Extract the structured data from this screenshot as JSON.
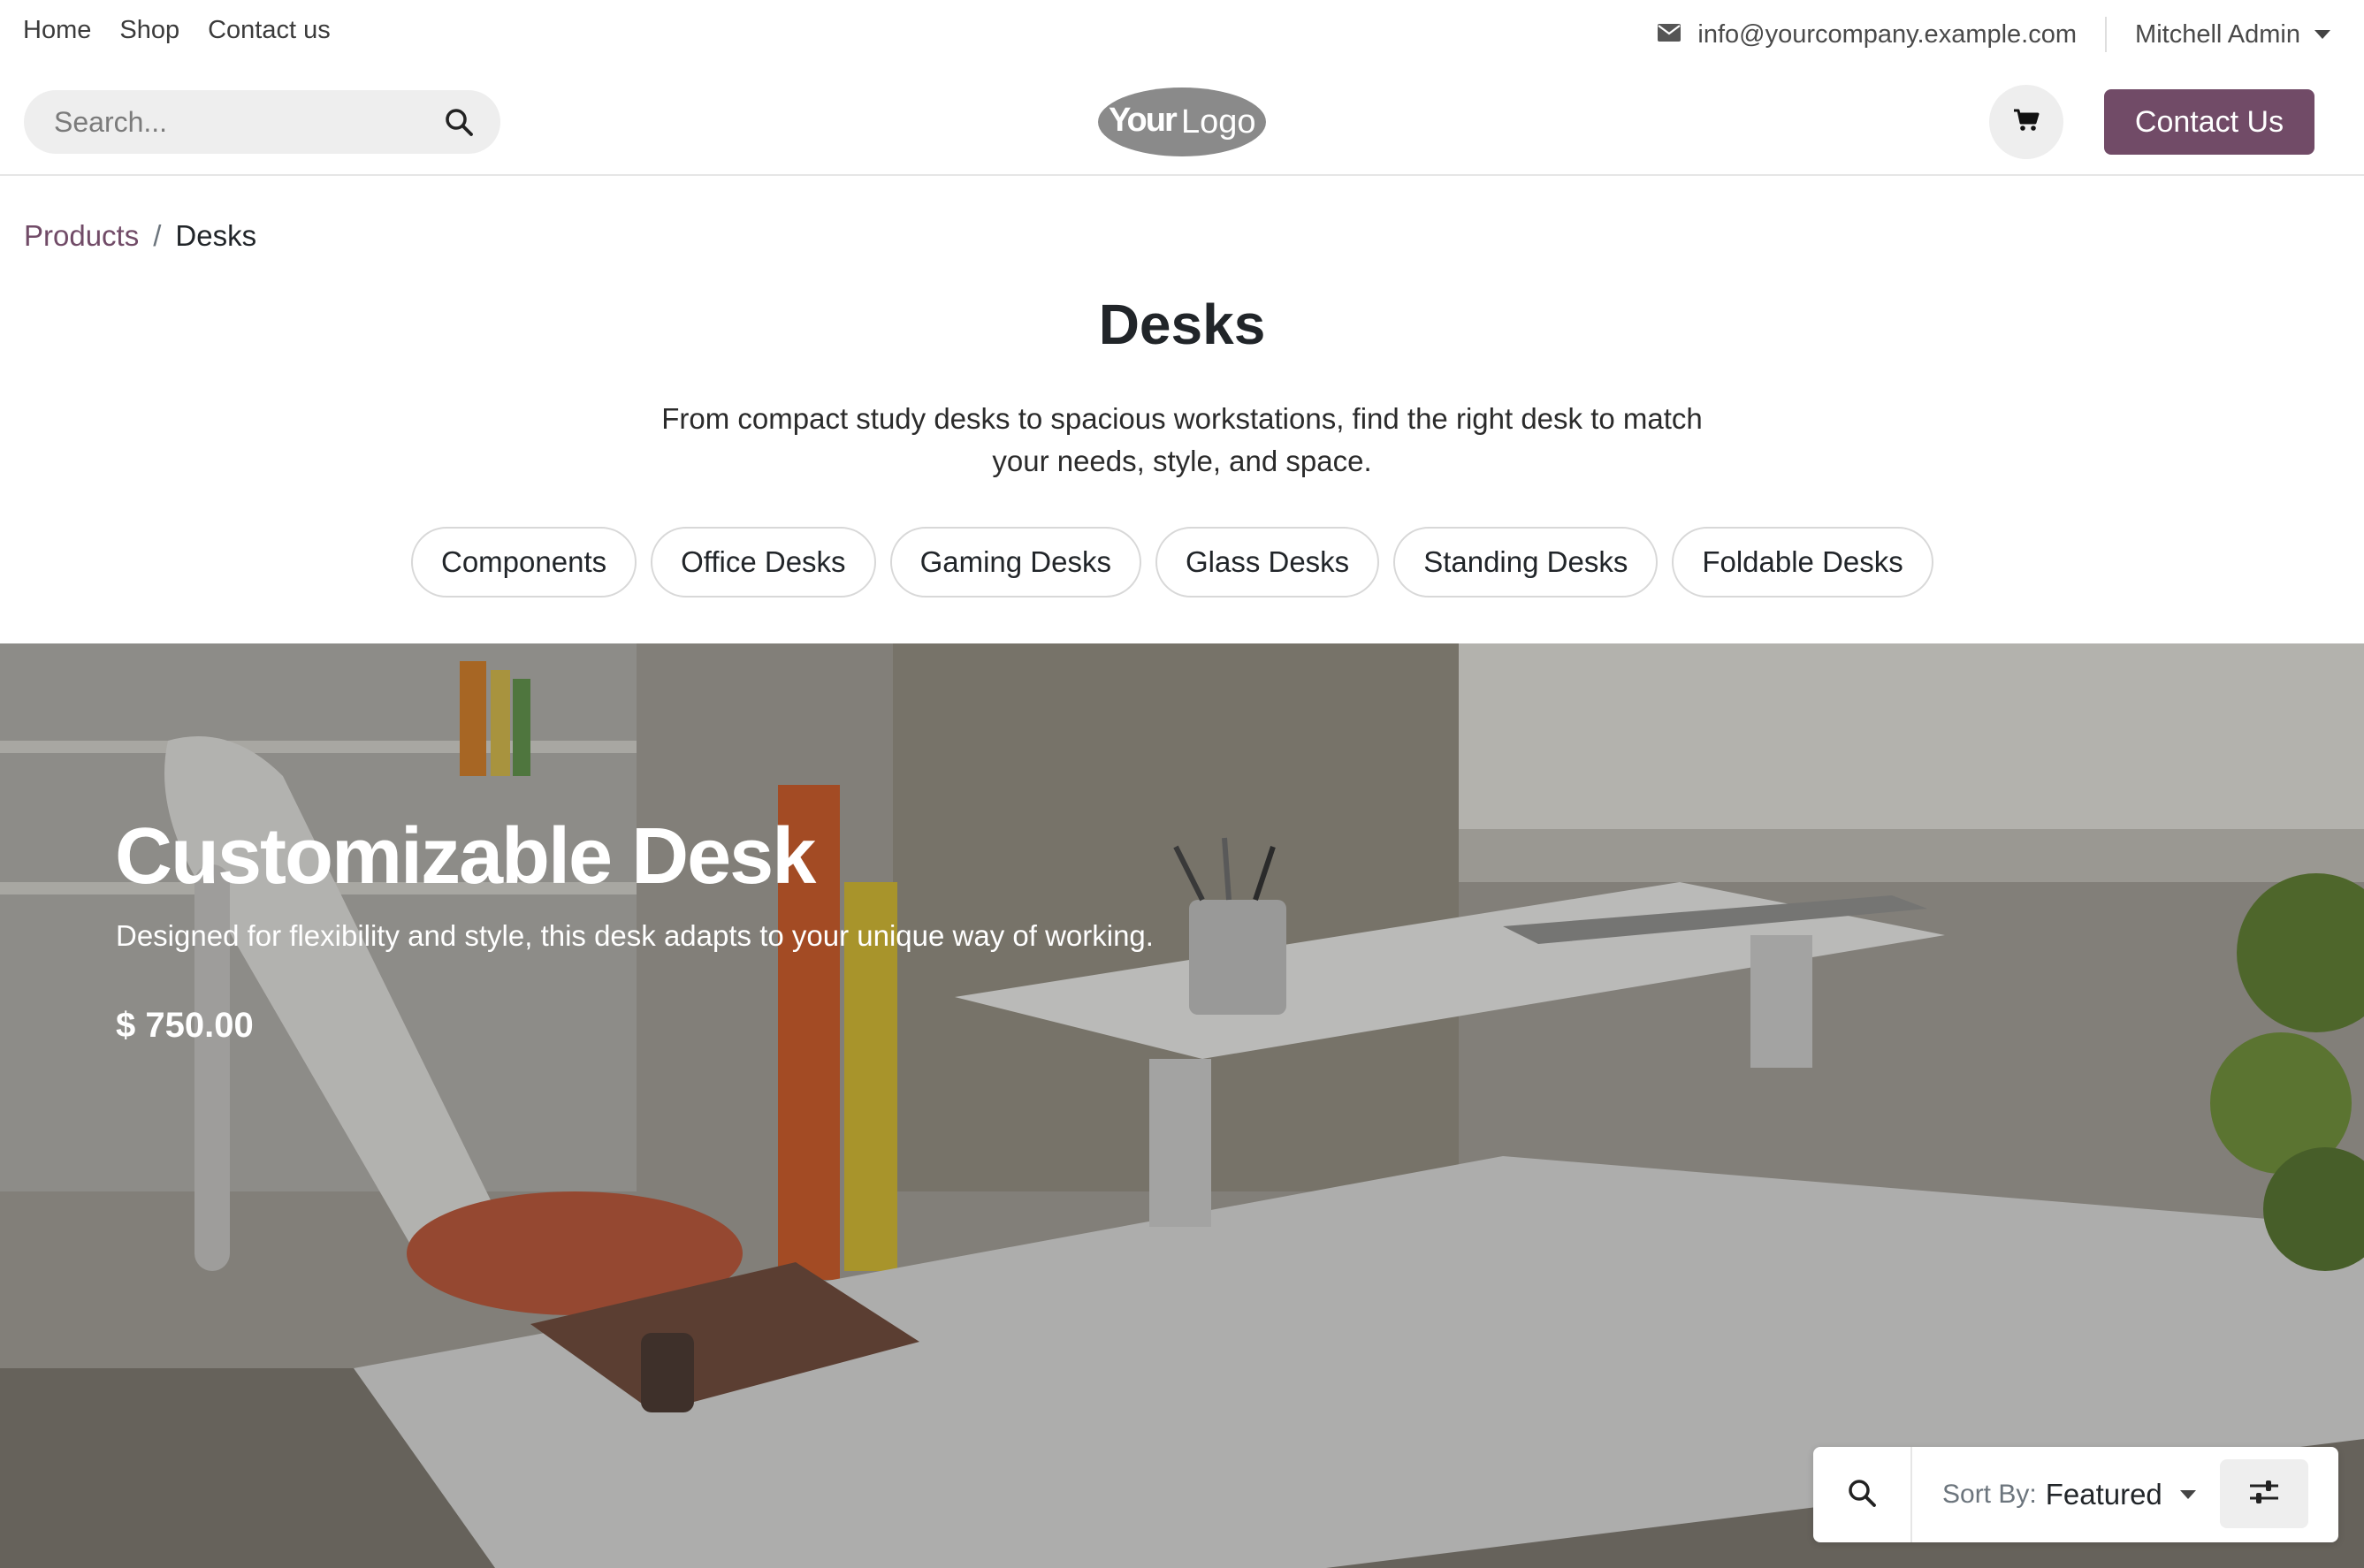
{
  "topbar": {
    "nav": [
      "Home",
      "Shop",
      "Contact us"
    ],
    "email": "info@yourcompany.example.com",
    "user": "Mitchell Admin"
  },
  "header": {
    "search_placeholder": "Search...",
    "logo_text_bold": "Your",
    "logo_text_light": "Logo",
    "cta_label": "Contact Us"
  },
  "breadcrumb": {
    "parent": "Products",
    "separator": "/",
    "current": "Desks"
  },
  "category": {
    "title": "Desks",
    "description": "From compact study desks to spacious workstations, find the right desk to match your needs, style, and space.",
    "subcategories": [
      "Components",
      "Office Desks",
      "Gaming Desks",
      "Glass Desks",
      "Standing Desks",
      "Foldable Desks"
    ]
  },
  "hero": {
    "title": "Customizable Desk",
    "subtitle": "Designed for flexibility and style, this desk adapts to your unique way of working.",
    "price": "$ 750.00"
  },
  "toolbar": {
    "sort_label": "Sort By:",
    "sort_value": "Featured"
  },
  "colors": {
    "brand": "#714b67",
    "chip_border": "#d8d8d8",
    "surface": "#eeeeee"
  },
  "icons": [
    "envelope-icon",
    "caret-down-icon",
    "search-icon",
    "cart-icon",
    "sliders-icon"
  ]
}
